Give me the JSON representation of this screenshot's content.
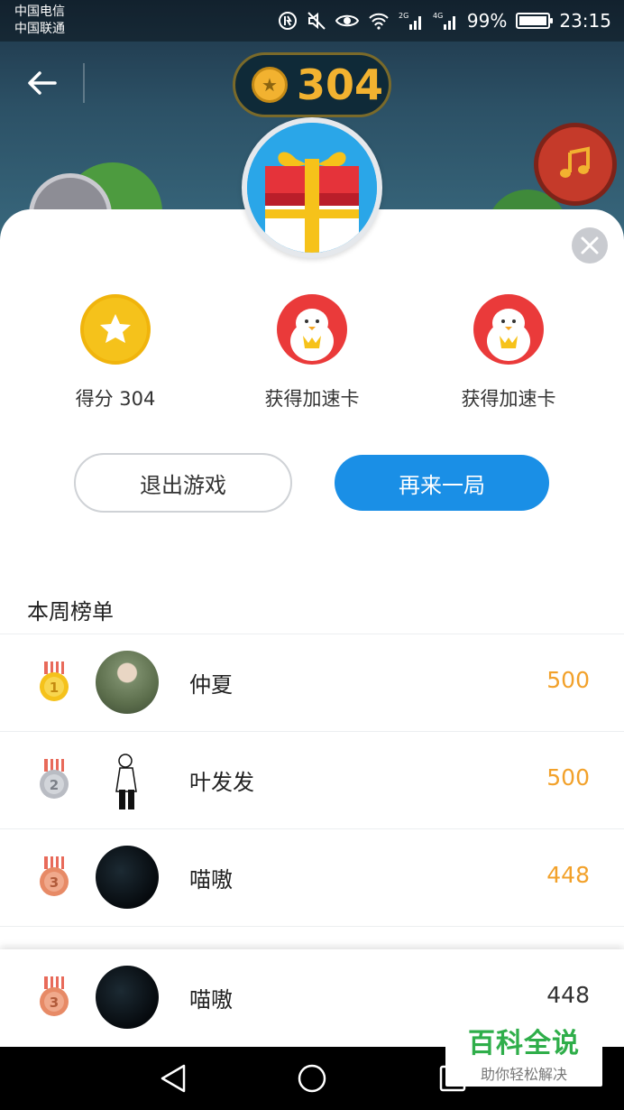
{
  "status_bar": {
    "carrier_1": "中国电信",
    "carrier_2": "中国联通",
    "network_1": "2G",
    "network_2": "4G",
    "battery": "99%",
    "time": "23:15"
  },
  "game_header": {
    "coin_score": "304"
  },
  "result": {
    "rewards": [
      {
        "icon": "star-coin-icon",
        "label": "得分 304"
      },
      {
        "icon": "chick-card-icon",
        "label": "获得加速卡"
      },
      {
        "icon": "chick-card-icon",
        "label": "获得加速卡"
      }
    ],
    "exit_label": "退出游戏",
    "again_label": "再来一局"
  },
  "leaderboard": {
    "title": "本周榜单",
    "rows": [
      {
        "rank": "1",
        "name": "仲夏",
        "score": "500"
      },
      {
        "rank": "2",
        "name": "叶发发",
        "score": "500"
      },
      {
        "rank": "3",
        "name": "喵嗷",
        "score": "448"
      }
    ],
    "me": {
      "rank": "3",
      "name": "喵嗷",
      "score": "448"
    }
  },
  "watermark": {
    "title": "百科全说",
    "subtitle": "助你轻松解决"
  },
  "colors": {
    "primary_button": "#1a8fe6",
    "score_orange": "#f2a12a",
    "gold": "#f5c21b",
    "medal_gold": "#f5c21b",
    "medal_silver": "#b9bcc3",
    "medal_bronze": "#e78a66"
  }
}
